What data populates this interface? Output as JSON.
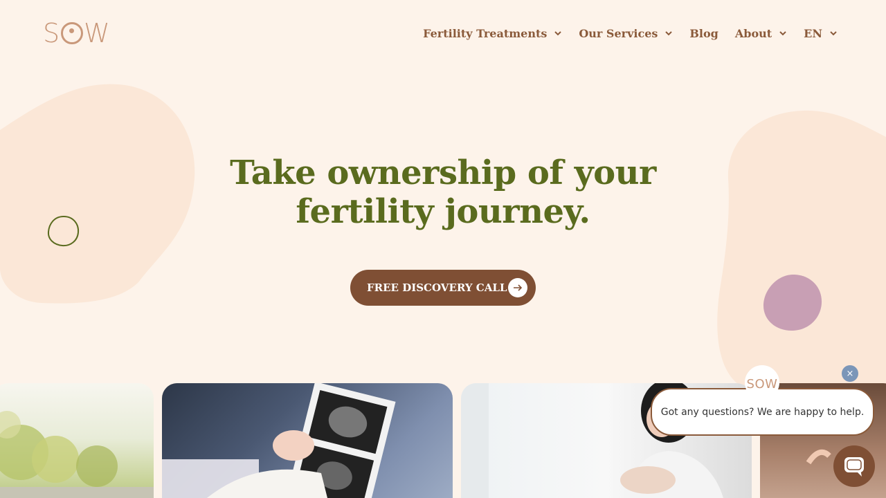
{
  "brand": {
    "logo_text": "SOW"
  },
  "nav": {
    "items": [
      {
        "label": "Fertility Treatments",
        "has_dropdown": true
      },
      {
        "label": "Our Services",
        "has_dropdown": true
      },
      {
        "label": "Blog",
        "has_dropdown": false
      },
      {
        "label": "About",
        "has_dropdown": true
      },
      {
        "label": "EN",
        "has_dropdown": true
      }
    ]
  },
  "hero": {
    "title_line1": "Take ownership of your",
    "title_line2": "fertility journey.",
    "cta_label": "FREE DISCOVERY CALL",
    "cta_icon": "arrow-right-icon"
  },
  "cards": [
    {
      "icon": "park-trees-photo"
    },
    {
      "icon": "ultrasound-photo"
    },
    {
      "icon": "pregnant-woman-photo"
    },
    {
      "icon": "partial-photo"
    }
  ],
  "chat": {
    "avatar_text": "SOW",
    "message": "Got any questions? We are happy to help.",
    "close_label": "×"
  },
  "colors": {
    "background": "#fdf3ea",
    "accent_brown": "#7f4f34",
    "title_green": "#5a6b1e",
    "nav_brown": "#8a5a3a",
    "logo_tan": "#c9987a"
  }
}
